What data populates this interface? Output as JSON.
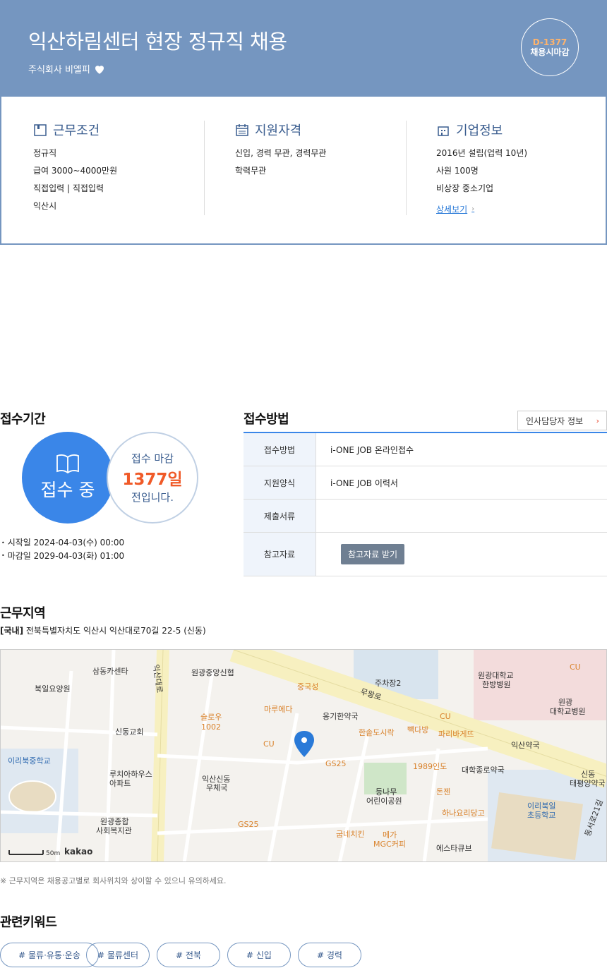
{
  "header": {
    "title": "익산하림센터 현장 정규직 채용",
    "company": "주식회사 비엘피",
    "dday": "D-1377",
    "dday_status": "채용시마감"
  },
  "conditions": {
    "title": "근무조건",
    "items": [
      "정규직",
      "급여 3000~4000만원",
      "직접입력 | 직접입력",
      "익산시"
    ]
  },
  "qualifications": {
    "title": "지원자격",
    "items": [
      "신입, 경력 무관, 경력무관",
      "학력무관"
    ]
  },
  "company_info": {
    "title": "기업정보",
    "items": [
      "2016년 설립(업력 10년)",
      "사원 100명",
      "비상장 중소기업"
    ],
    "detail_link": "상세보기"
  },
  "period": {
    "title": "접수기간",
    "status": "접수 중",
    "deadline_label": "접수 마감",
    "days_left": "1377일",
    "suffix": "전입니다.",
    "start": "시작일 2024-04-03(수) 00:00",
    "end": "마감일 2029-04-03(화) 01:00"
  },
  "method": {
    "title": "접수방법",
    "hr_button": "인사담당자 정보",
    "rows": [
      {
        "label": "접수방법",
        "value": "i-ONE JOB 온라인접수"
      },
      {
        "label": "지원양식",
        "value": "i-ONE JOB 이력서"
      },
      {
        "label": "제출서류",
        "value": ""
      },
      {
        "label": "참고자료",
        "button": "참고자료 받기"
      }
    ]
  },
  "location": {
    "title": "근무지역",
    "region": "[국내]",
    "address": "전북특별자치도 익산시 익산대로70길 22-5 (신동)",
    "scale": "50m",
    "provider": "kakao",
    "note": "※ 근무지역은 채용공고별로 회사위치와 상이할 수 있으니 유의하세요."
  },
  "map_labels": [
    {
      "t": "삼동카센타",
      "c": ""
    },
    {
      "t": "원광중앙신협",
      "c": ""
    },
    {
      "t": "북일요양원",
      "c": ""
    },
    {
      "t": "중국성",
      "c": "or"
    },
    {
      "t": "주차장2",
      "c": ""
    },
    {
      "t": "원광대학교",
      "c": ""
    },
    {
      "t": "한방병원",
      "c": ""
    },
    {
      "t": "CU",
      "c": "or"
    },
    {
      "t": "슬로우",
      "c": "or"
    },
    {
      "t": "1002",
      "c": "or"
    },
    {
      "t": "마루에다",
      "c": "or"
    },
    {
      "t": "옹기한약국",
      "c": ""
    },
    {
      "t": "원광",
      "c": ""
    },
    {
      "t": "대학교병원",
      "c": ""
    },
    {
      "t": "신동교회",
      "c": ""
    },
    {
      "t": "CU",
      "c": "or"
    },
    {
      "t": "한솥도시락",
      "c": "or"
    },
    {
      "t": "빽다방",
      "c": "or"
    },
    {
      "t": "CU",
      "c": "or"
    },
    {
      "t": "파리바게뜨",
      "c": "or"
    },
    {
      "t": "익산약국",
      "c": ""
    },
    {
      "t": "이리북중학교",
      "c": "bl"
    },
    {
      "t": "GS25",
      "c": "or"
    },
    {
      "t": "1989인도",
      "c": "or"
    },
    {
      "t": "대학종로약국",
      "c": ""
    },
    {
      "t": "루치아하우스",
      "c": ""
    },
    {
      "t": "아파트",
      "c": ""
    },
    {
      "t": "익산신동",
      "c": ""
    },
    {
      "t": "우체국",
      "c": ""
    },
    {
      "t": "등나무",
      "c": ""
    },
    {
      "t": "어린이공원",
      "c": ""
    },
    {
      "t": "돈젠",
      "c": "or"
    },
    {
      "t": "신동",
      "c": ""
    },
    {
      "t": "태평양약국",
      "c": ""
    },
    {
      "t": "이리북일",
      "c": "bl"
    },
    {
      "t": "초등학교",
      "c": "bl"
    },
    {
      "t": "원광종합",
      "c": ""
    },
    {
      "t": "사회복지관",
      "c": ""
    },
    {
      "t": "하나요리당고",
      "c": "or"
    },
    {
      "t": "GS25",
      "c": "or"
    },
    {
      "t": "굽네치킨",
      "c": "or"
    },
    {
      "t": "메가",
      "c": "or"
    },
    {
      "t": "MGC커피",
      "c": "or"
    },
    {
      "t": "에스타큐브",
      "c": ""
    },
    {
      "t": "무왕로",
      "c": ""
    },
    {
      "t": "익산대로",
      "c": ""
    },
    {
      "t": "동서로21길",
      "c": ""
    }
  ],
  "keywords": {
    "title": "관련키워드",
    "items": [
      "# 물류·유통·운송",
      "# 물류센터",
      "# 전북",
      "# 신입",
      "# 경력"
    ]
  }
}
